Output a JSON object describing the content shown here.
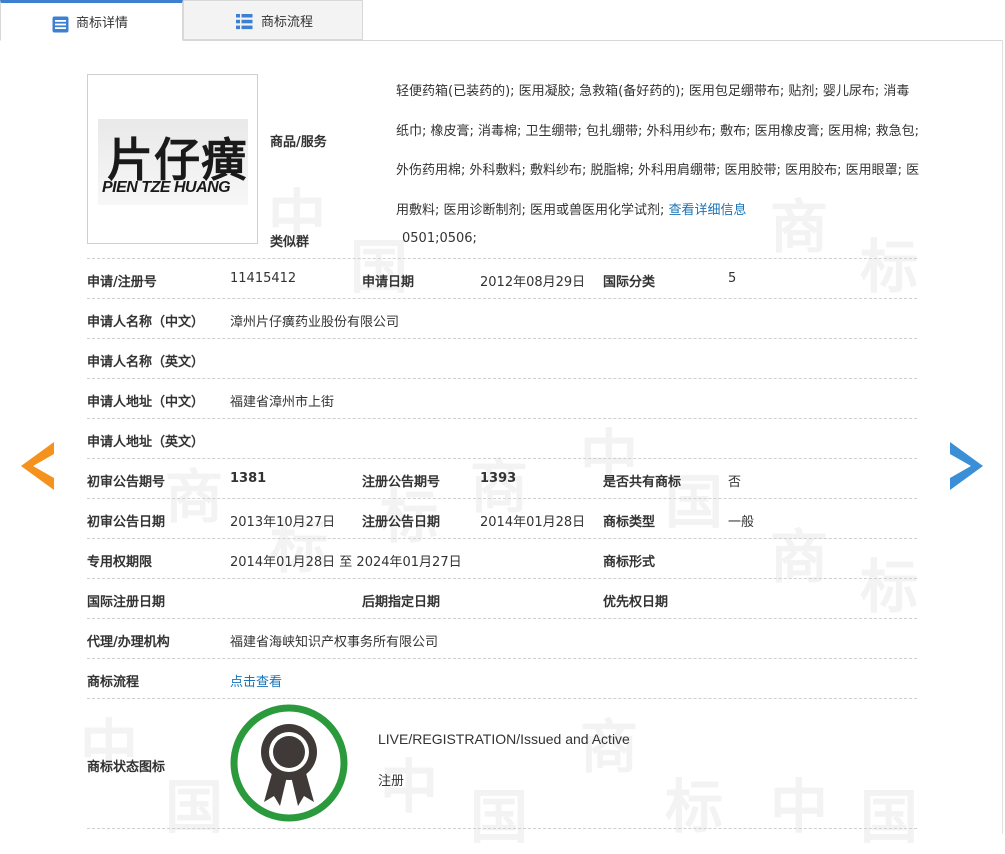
{
  "tabs": [
    {
      "label": "商标详情",
      "active": true
    },
    {
      "label": "商标流程",
      "active": false
    }
  ],
  "watermark": [
    "中",
    "国",
    "商",
    "标",
    "中",
    "国",
    "商",
    "标",
    "中",
    "国",
    "商",
    "标",
    "中",
    "国",
    "商",
    "标",
    "中",
    "国",
    "商",
    "标"
  ],
  "logo": {
    "cn": "片仔癀",
    "en": "PIEN TZE HUANG"
  },
  "labels": {
    "goods": "商品/服务",
    "similar": "类似群",
    "reg_no": "申请/注册号",
    "apply_date": "申请日期",
    "intl_class": "国际分类",
    "applicant_cn": "申请人名称（中文）",
    "applicant_en": "申请人名称（英文）",
    "address_cn": "申请人地址（中文）",
    "address_en": "申请人地址（英文）",
    "prelim_no": "初审公告期号",
    "reg_ann_no": "注册公告期号",
    "shared": "是否共有商标",
    "prelim_date": "初审公告日期",
    "reg_ann_date": "注册公告日期",
    "tm_type": "商标类型",
    "exclusive_period": "专用权期限",
    "tm_form": "商标形式",
    "intl_reg_date": "国际注册日期",
    "later_designation": "后期指定日期",
    "priority_date": "优先权日期",
    "agent": "代理/办理机构",
    "process": "商标流程",
    "status_icon": "商标状态图标"
  },
  "values": {
    "goods_text": "轻便药箱(已装药的); 医用凝胶; 急救箱(备好药的); 医用包足绷带布; 贴剂; 婴儿尿布; 消毒纸巾; 橡皮膏; 消毒棉; 卫生绷带; 包扎绷带; 外科用纱布; 敷布; 医用橡皮膏; 医用棉; 救急包; 外伤药用棉; 外科敷料; 敷料纱布; 脱脂棉; 外科用肩绷带; 医用胶带; 医用胶布; 医用眼罩; 医用敷料; 医用诊断制剂; 医用或兽医用化学试剂; ",
    "goods_more": "查看详细信息",
    "similar": "0501;0506;",
    "reg_no": "11415412",
    "apply_date": "2012年08月29日",
    "intl_class": "5",
    "applicant_cn": "漳州片仔癀药业股份有限公司",
    "applicant_en": "",
    "address_cn": "福建省漳州市上街",
    "address_en": "",
    "prelim_no": "1381",
    "reg_ann_no": "1393",
    "shared": "否",
    "prelim_date": "2013年10月27日",
    "reg_ann_date": "2014年01月28日",
    "tm_type": "一般",
    "exclusive_period": "2014年01月28日 至 2024年01月27日",
    "tm_form": "",
    "intl_reg_date": "",
    "later_designation": "",
    "priority_date": "",
    "agent": "福建省海峡知识产权事务所有限公司",
    "process_link": "点击查看",
    "status_en": "LIVE/REGISTRATION/Issued and Active",
    "status_cn": "注册"
  },
  "icons": {
    "tab_detail": "document-list-icon",
    "tab_process": "list-icon",
    "prev": "arrow-left-icon",
    "next": "arrow-right-icon",
    "status": "award-ribbon-icon"
  },
  "colors": {
    "accent": "#3d7fd1",
    "link": "#1a74b8",
    "prev_arrow": "#f5921e",
    "next_arrow": "#3b8fd6",
    "status_ring": "#2a9a3c",
    "medal": "#3f3a37"
  }
}
